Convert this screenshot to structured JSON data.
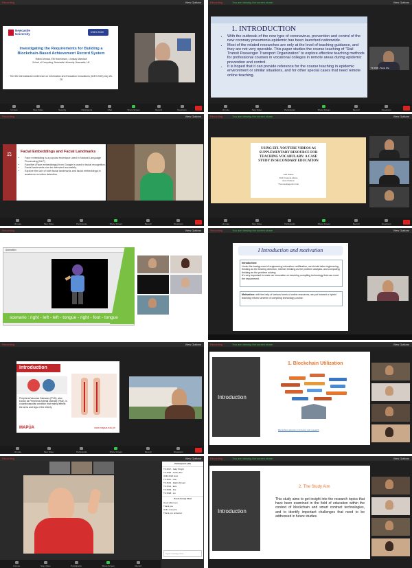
{
  "window": {
    "recording_label": "Recording",
    "view_options": "View Options",
    "speaker_title": "You are viewing the screen share"
  },
  "toolbar": {
    "items": [
      "Unmute",
      "Stop Video",
      "Security",
      "Participants",
      "Chat",
      "Share Screen",
      "Record",
      "Reactions",
      "More"
    ],
    "end_label": "End"
  },
  "p1": {
    "logo": "Newcastle University",
    "conf_badge": "ICIEI 2020",
    "title": "Investigating the Requirements for Building a Blockchain-Based Achievement Record System",
    "authors": "Rabiri Ahmad, Effi Hutchinson, Lindsay Marshall",
    "affiliation": "School of Computing, Newcastle University, Newcastle, UK",
    "conference": "The 5th International Conference on Information and Education Innovations (ICIEI 2020) July 26-28"
  },
  "p2": {
    "heading": "1.  INTRODUCTION",
    "bullets": [
      "With the outbreak of the new type of coronavirus, prevention and control of the new coronary pneumonia epidemic has been launched nationwide.",
      "Most of the related researches are only at the level of teaching guidance, and they are not very operable. This paper studies the course teaching of \"Rail Transit Passenger Transport Organization\" to explore effective teaching methods for professional courses in vocational colleges in remote areas during epidemic prevention and control.",
      "It is hoped that it can provide reference for the course teaching in epidemic environment or similar situations, and for other special cases that need remote online teaching."
    ],
    "participant": "TF 2506 -Tianlu Zhu"
  },
  "p3": {
    "heading": "Facial Embeddings and Facial Landmarks",
    "bullets": [
      "Face embedding is a popular technique used in Natural Language Processing (NLP)",
      "FaceNet (Face embeddings) from Google is used in facial recognition.",
      "Facial landmarks can be detected accurately.",
      "Explore the use of both facial landmarks and facial embeddings in academic emotion detection."
    ]
  },
  "p4": {
    "title": "USING EFL YOUTUBE VIDEOS AS SUPPLEMENTARY RESOURCE FOR TEACHING VOCABULARY: A CASE STUDY IN SECONDARY EDUCATION",
    "authors": [
      "Lalit Nitase",
      "Ruth Catenia Altosa",
      "Eva Chalsea",
      "Thomas Eugenion Cal"
    ]
  },
  "p5": {
    "window_title": "Animation",
    "caption": "scenario : right - left - left - tongue - right - foot - tongue"
  },
  "p6": {
    "heading": "I  Introduction and motivation",
    "intro_label": "Introduction:",
    "intro_text": "Under the background of engineering education certification, we should take engineering thinking as the bearing direction, Internet thinking as the problem analysis, and computing thinking as the problem solving.",
    "intro_text2": "It's very important to make an innovation on teaching compiling technology that can meet the requirement.",
    "motivation_label": "Motivation:",
    "motivation_text": "with the help of various forms of online resources, we put forward a hybrid teaching reform scheme of compiling technology course."
  },
  "p7": {
    "heading": "Introduction",
    "text": "Peripheral Vascular Diseases (PVD), also known as Peripheral Arterial Disease (PAD), is a cardiovascular condition that mainly affects the arms and legs of the elderly",
    "brand": "MAPÚA",
    "url": "www.mapua.edu.ph"
  },
  "p8": {
    "left_label": "Introduction",
    "heading": "1. Blockchain Utilization",
    "chip_labels": [
      "Finance",
      "Healthcare",
      "Education",
      "Supply Chain",
      "Energy",
      "Identity",
      "Voting",
      "Real Estate",
      "Insurance",
      "IoT",
      "Media",
      "Legal"
    ],
    "caption": "Blockchain adoption in industry and research"
  },
  "p9": {
    "chat_title": "Participants (15)",
    "participants": [
      "TF 2517 - Sally Wright",
      "TF 2506 - Tianlu Zhu",
      "ICIEI 2020 Host",
      "TF 2511 - Ivan",
      "TF 2513 - Rabiri Ahmad",
      "TF 2512 - Eva",
      "TF 2509 - Rui",
      "TF 2508 - Lin"
    ],
    "chat_header": "Zoom Group Chat",
    "chat_messages": [
      "Good afternoon",
      "Thank you",
      "Hello everyone",
      "Thank you professor"
    ],
    "chat_placeholder": "Type message here..."
  },
  "p10": {
    "left_label": "Introduction",
    "heading": "2. The Study Aim",
    "text": "This study aims to get insight into the research topics that have been examined in the field of education within the context of blockchain and smart contract technologies, and to identify important challenges that need to be addressed in future studies."
  },
  "colors": {
    "zoom_bg": "#1f1f1f",
    "end_red": "#d22222",
    "ncl_blue": "#2a3f8f",
    "title_blue": "#1f5fa8",
    "mapua_red": "#c0272d",
    "green_banner": "#7ac143",
    "orange_heading": "#e8752a"
  }
}
